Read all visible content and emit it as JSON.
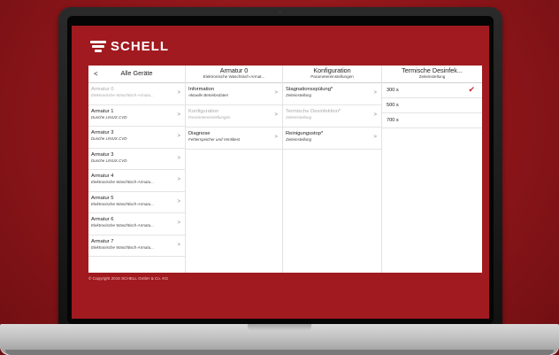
{
  "brand": {
    "name": "SCHELL"
  },
  "columns": {
    "all_devices": {
      "back_label": "<",
      "title": "Alle Geräte",
      "items": [
        {
          "title": "Armatur 0",
          "subtitle": "Elektronische Waschtisch-Armatu...",
          "disabled": true
        },
        {
          "title": "Armatur 1",
          "subtitle": "Dusche LINUS CVD",
          "disabled": false
        },
        {
          "title": "Armatur 3",
          "subtitle": "Dusche LINUS CVD",
          "disabled": false
        },
        {
          "title": "Armatur 3",
          "subtitle": "Dusche LINUS CVD",
          "disabled": false
        },
        {
          "title": "Armatur 4",
          "subtitle": "Elektronische Waschtisch-Armatu...",
          "disabled": false
        },
        {
          "title": "Armatur 5",
          "subtitle": "Elektronische Waschtisch-Armatu...",
          "disabled": false
        },
        {
          "title": "Armatur 6",
          "subtitle": "Elektronische Waschtisch-Armatu...",
          "disabled": false
        },
        {
          "title": "Armatur 7",
          "subtitle": "Elektronische Waschtisch-Armatu...",
          "disabled": false
        }
      ]
    },
    "device": {
      "title": "Armatur 0",
      "subtitle": "Elektronische Waschtisch-Armat...",
      "items": [
        {
          "title": "Information",
          "subtitle": "Aktuelle Betriebsdaten",
          "disabled": false
        },
        {
          "title": "Konfiguration",
          "subtitle": "Parametereinstellungen",
          "disabled": true
        },
        {
          "title": "Diagnose",
          "subtitle": "Fehlerspeicher und Ventiltest",
          "disabled": false
        }
      ]
    },
    "config": {
      "title": "Konfiguration",
      "subtitle": "Parametereinstellungen",
      "items": [
        {
          "title": "Stagnationsspülung*",
          "subtitle": "Zeiteinstellung",
          "disabled": false
        },
        {
          "title": "Termische Desinfektion*",
          "subtitle": "Zeiteinstellung",
          "disabled": true
        },
        {
          "title": "Reinigungsstop*",
          "subtitle": "Zeiteinstellung",
          "disabled": false
        }
      ]
    },
    "disinfection": {
      "title": "Termische Desinfek...",
      "subtitle": "Zeiteinstellung",
      "options": [
        {
          "label": "300 s",
          "selected": true
        },
        {
          "label": "500 s",
          "selected": false
        },
        {
          "label": "700 s",
          "selected": false
        }
      ]
    }
  },
  "chevron": ">",
  "checkmark": "✔",
  "footer": {
    "copyright": "© Copyright 2016 SCHELL GmbH & Co. KG"
  }
}
